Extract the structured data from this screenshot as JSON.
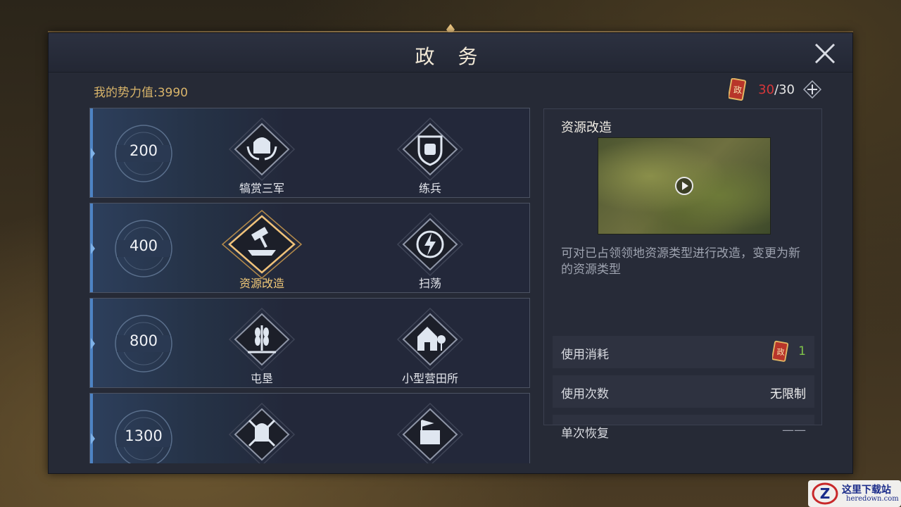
{
  "window": {
    "title": "政 务"
  },
  "header": {
    "power_label": "我的势力值:3990",
    "token_current": "30",
    "token_max": "/30"
  },
  "rows": [
    {
      "cost": "200",
      "skills": [
        {
          "label": "犒赏三军",
          "icon": "helmet-laurel-icon"
        },
        {
          "label": "练兵",
          "icon": "fist-shield-icon"
        }
      ]
    },
    {
      "cost": "400",
      "skills": [
        {
          "label": "资源改造",
          "icon": "hammer-anvil-icon",
          "selected": true
        },
        {
          "label": "扫荡",
          "icon": "lightning-icon"
        }
      ]
    },
    {
      "cost": "800",
      "skills": [
        {
          "label": "屯垦",
          "icon": "wheat-icon"
        },
        {
          "label": "小型营田所",
          "icon": "house-tree-icon"
        }
      ]
    },
    {
      "cost": "1300",
      "skills": [
        {
          "icon": "spartan-helmet-swords-icon"
        },
        {
          "icon": "resource-pile-icon"
        }
      ]
    }
  ],
  "detail": {
    "title": "资源改造",
    "description": "可对已占领领地资源类型进行改造，变更为新的资源类型",
    "stats": [
      {
        "label": "使用消耗",
        "value": "1"
      },
      {
        "label": "使用次数",
        "value": "无限制"
      },
      {
        "label": "单次恢复",
        "value": "——"
      }
    ]
  },
  "watermark": {
    "title": "这里下载站",
    "url": "heredown.com"
  },
  "colors": {
    "accent_gold": "#f2c978",
    "token_red": "#d6373a",
    "consume_green": "#7fc34a",
    "row_blue": "#4d83c4"
  }
}
